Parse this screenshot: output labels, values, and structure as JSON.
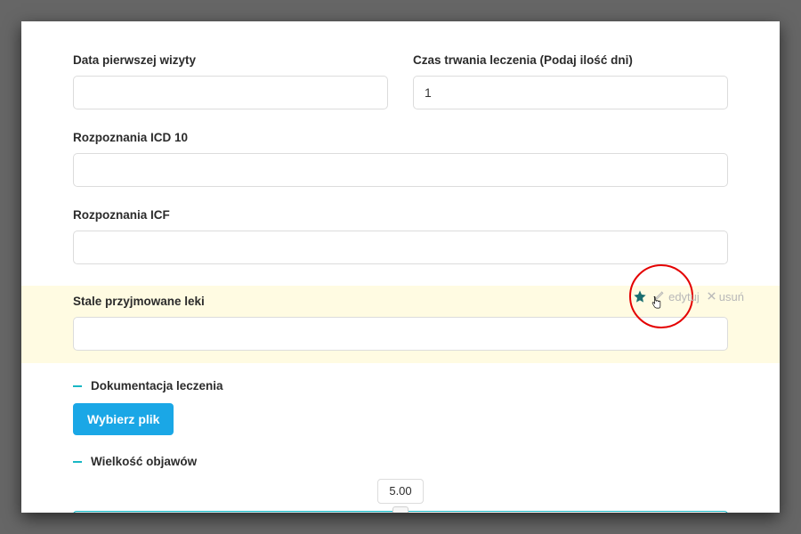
{
  "fields": {
    "first_visit_date": {
      "label": "Data pierwszej wizyty",
      "value": ""
    },
    "treatment_duration": {
      "label": "Czas trwania leczenia (Podaj ilość dni)",
      "value": "1"
    },
    "icd10": {
      "label": "Rozpoznania ICD 10",
      "value": ""
    },
    "icf": {
      "label": "Rozpoznania ICF",
      "value": ""
    },
    "medications": {
      "label": "Stale przyjmowane leki",
      "value": ""
    }
  },
  "actions": {
    "edit_label": "edytuj",
    "delete_label": "usuń"
  },
  "doc_section": {
    "title": "Dokumentacja leczenia",
    "button": "Wybierz plik"
  },
  "symptoms_section": {
    "title": "Wielkość objawów",
    "value": "5.00"
  },
  "colors": {
    "accent": "#19b7c4",
    "primary_button": "#1aa7e6",
    "highlight_bg": "#fffbe2",
    "annotation": "#e40000"
  }
}
